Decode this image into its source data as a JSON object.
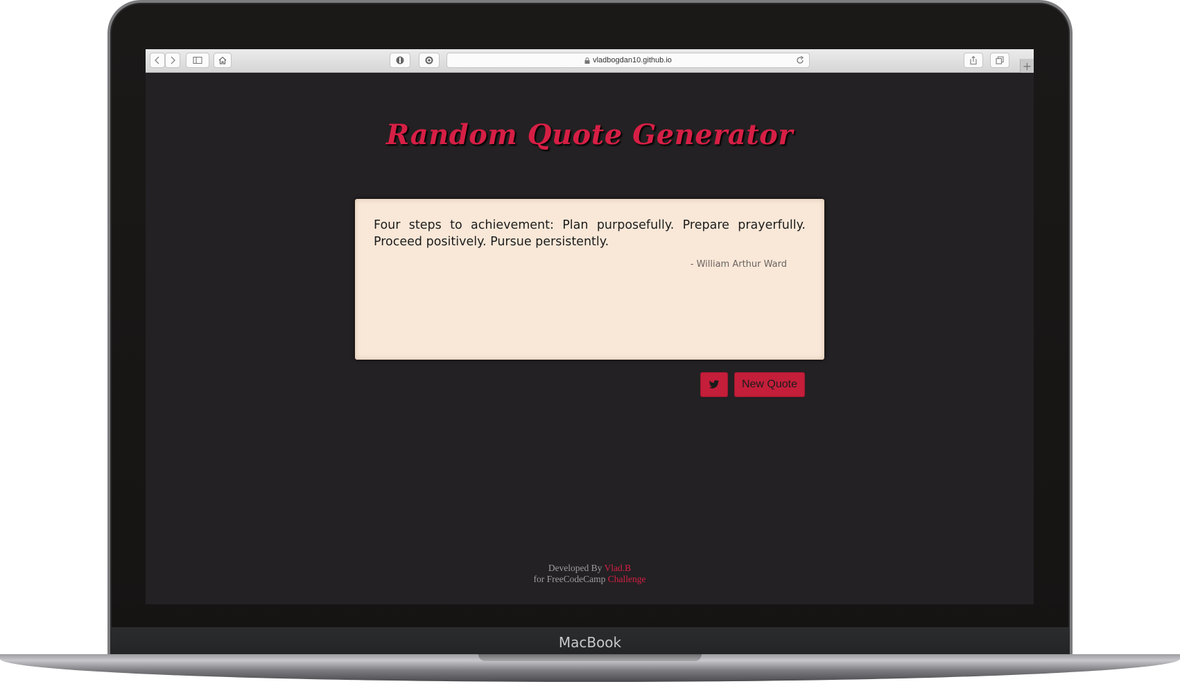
{
  "device": {
    "brand_label": "MacBook"
  },
  "browser": {
    "url": "vladbogdan10.github.io",
    "buttons": {
      "back": "back-arrow",
      "forward": "forward-arrow",
      "sidebar": "sidebar-icon",
      "home": "home-icon",
      "privacy": "privacy-icon",
      "extension": "extension-icon",
      "reload": "reload-icon",
      "share": "share-icon",
      "tabs": "tabs-icon",
      "new_tab": "+"
    }
  },
  "page": {
    "title": "Random Quote Generator",
    "quote": {
      "text": "Four steps to achievement: Plan purposefully. Prepare prayerfully. Proceed positively. Pursue persistently.",
      "author": "- William Arthur Ward"
    },
    "buttons": {
      "tweet_icon": "twitter-icon",
      "new_quote": "New Quote"
    },
    "footer": {
      "line1_prefix": "Developed By ",
      "line1_link": "Vlad.B",
      "line2_prefix": "for FreeCodeCamp ",
      "line2_link": "Challenge"
    }
  },
  "colors": {
    "accent": "#d61f45",
    "page_background": "#232123",
    "card_background": "#f9e8d8",
    "button": "#c41e3a"
  }
}
